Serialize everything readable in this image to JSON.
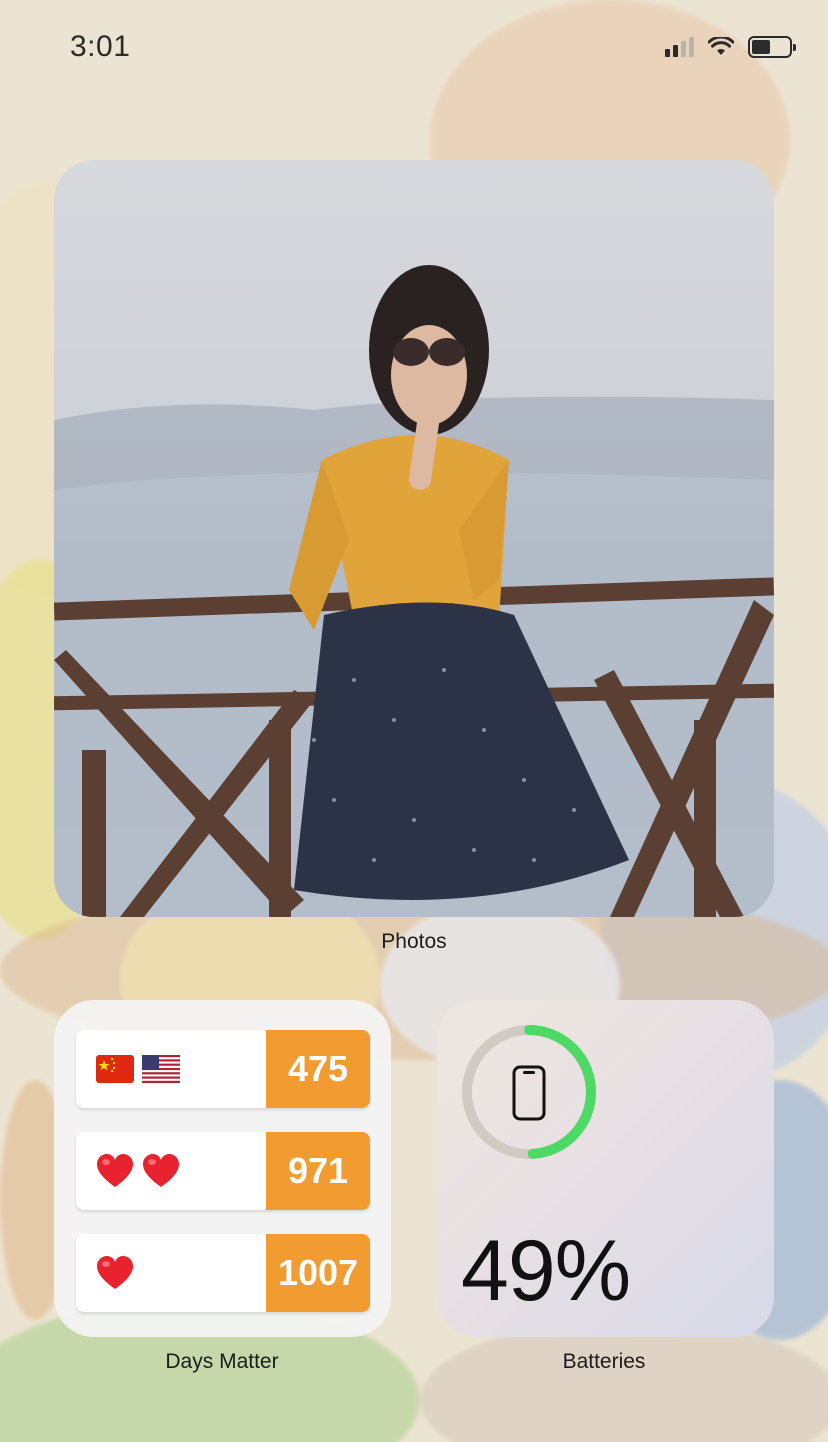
{
  "status_bar": {
    "time": "3:01",
    "battery_level": 0.49
  },
  "widgets": {
    "photos": {
      "label": "Photos"
    },
    "days_matter": {
      "label": "Days Matter",
      "rows": [
        {
          "icons": [
            "china-flag-icon",
            "us-flag-icon"
          ],
          "count": "475"
        },
        {
          "icons": [
            "red-heart-icon",
            "red-heart-icon"
          ],
          "count": "971"
        },
        {
          "icons": [
            "red-heart-icon"
          ],
          "count": "1007"
        }
      ],
      "accent_color": "#f29b30"
    },
    "batteries": {
      "label": "Batteries",
      "percent_text": "49%",
      "level": 0.49,
      "ring_color": "#4cd964",
      "icon": "phone-icon"
    }
  }
}
